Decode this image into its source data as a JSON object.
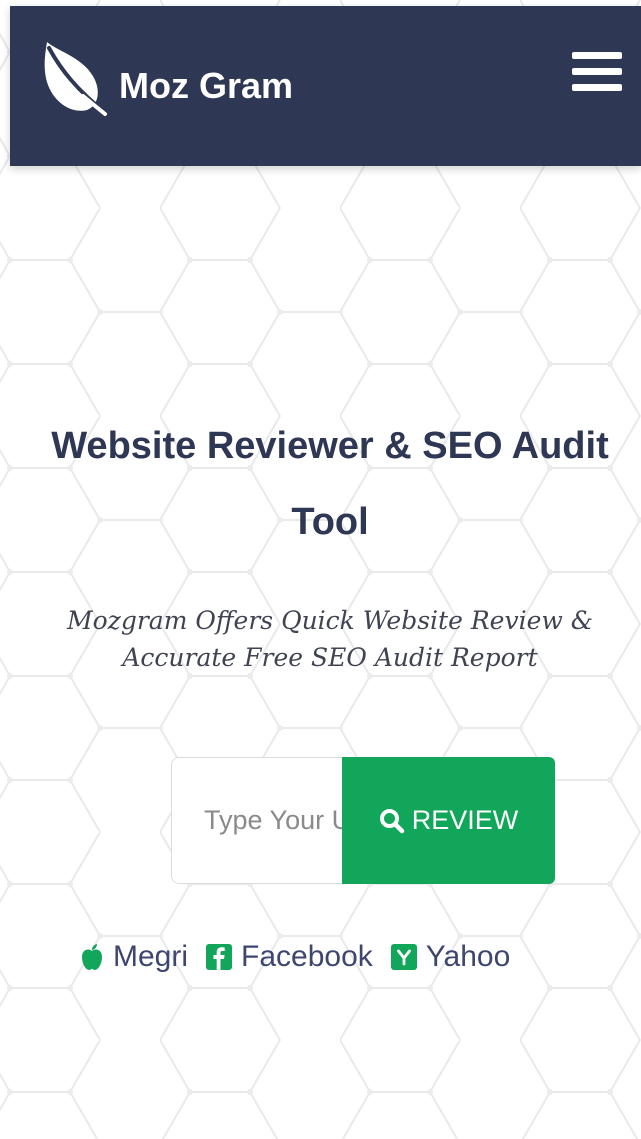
{
  "header": {
    "brand_name": "Moz Gram",
    "logo_icon": "leaf-icon",
    "menu_icon": "hamburger-menu-icon"
  },
  "hero": {
    "title": "Website Reviewer & SEO Audit Tool",
    "subtitle": "Mozgram Offers Quick Website Review & Accurate Free SEO Audit Report"
  },
  "search": {
    "placeholder": "Type Your URL",
    "button_label": "REVIEW",
    "button_icon": "search-icon"
  },
  "quick_links": [
    {
      "label": "Megri",
      "icon": "apple-icon"
    },
    {
      "label": "Facebook",
      "icon": "facebook-icon"
    },
    {
      "label": "Yahoo",
      "icon": "yahoo-icon"
    }
  ],
  "colors": {
    "navbar": "#2e3753",
    "title_text": "#2e3753",
    "review_button": "#12a65a",
    "icon_green": "#12a65a",
    "link_text": "#3e4670"
  }
}
